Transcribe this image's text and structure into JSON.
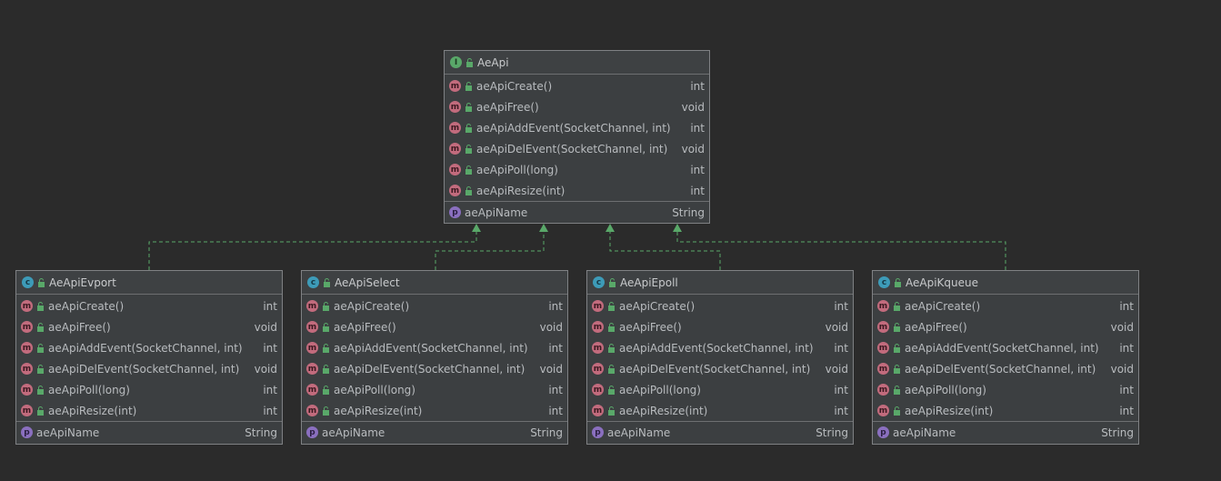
{
  "interface": {
    "kind_letter": "I",
    "name": "AeApi",
    "methods": [
      {
        "name": "aeApiCreate()",
        "type": "int"
      },
      {
        "name": "aeApiFree()",
        "type": "void"
      },
      {
        "name": "aeApiAddEvent(SocketChannel, int)",
        "type": "int"
      },
      {
        "name": "aeApiDelEvent(SocketChannel, int)",
        "type": "void"
      },
      {
        "name": "aeApiPoll(long)",
        "type": "int"
      },
      {
        "name": "aeApiResize(int)",
        "type": "int"
      }
    ],
    "property": {
      "name": "aeApiName",
      "type": "String"
    }
  },
  "classes": [
    {
      "kind_letter": "c",
      "name": "AeApiEvport"
    },
    {
      "kind_letter": "c",
      "name": "AeApiSelect"
    },
    {
      "kind_letter": "c",
      "name": "AeApiEpoll"
    },
    {
      "kind_letter": "c",
      "name": "AeApiKqueue"
    }
  ],
  "class_methods": [
    {
      "name": "aeApiCreate()",
      "type": "int"
    },
    {
      "name": "aeApiFree()",
      "type": "void"
    },
    {
      "name": "aeApiAddEvent(SocketChannel, int)",
      "type": "int"
    },
    {
      "name": "aeApiDelEvent(SocketChannel, int)",
      "type": "void"
    },
    {
      "name": "aeApiPoll(long)",
      "type": "int"
    },
    {
      "name": "aeApiResize(int)",
      "type": "int"
    }
  ],
  "class_property": {
    "name": "aeApiName",
    "type": "String"
  },
  "method_badge_letter": "m",
  "property_badge_letter": "p",
  "colors": {
    "background": "#2b2b2b",
    "box": "#3c3f41",
    "edge": "#59a869",
    "interface_badge": "#59a869",
    "class_badge": "#3d9bb8",
    "method_badge": "#c26b7d",
    "property_badge": "#8a6fbf"
  },
  "relationship": "realization"
}
